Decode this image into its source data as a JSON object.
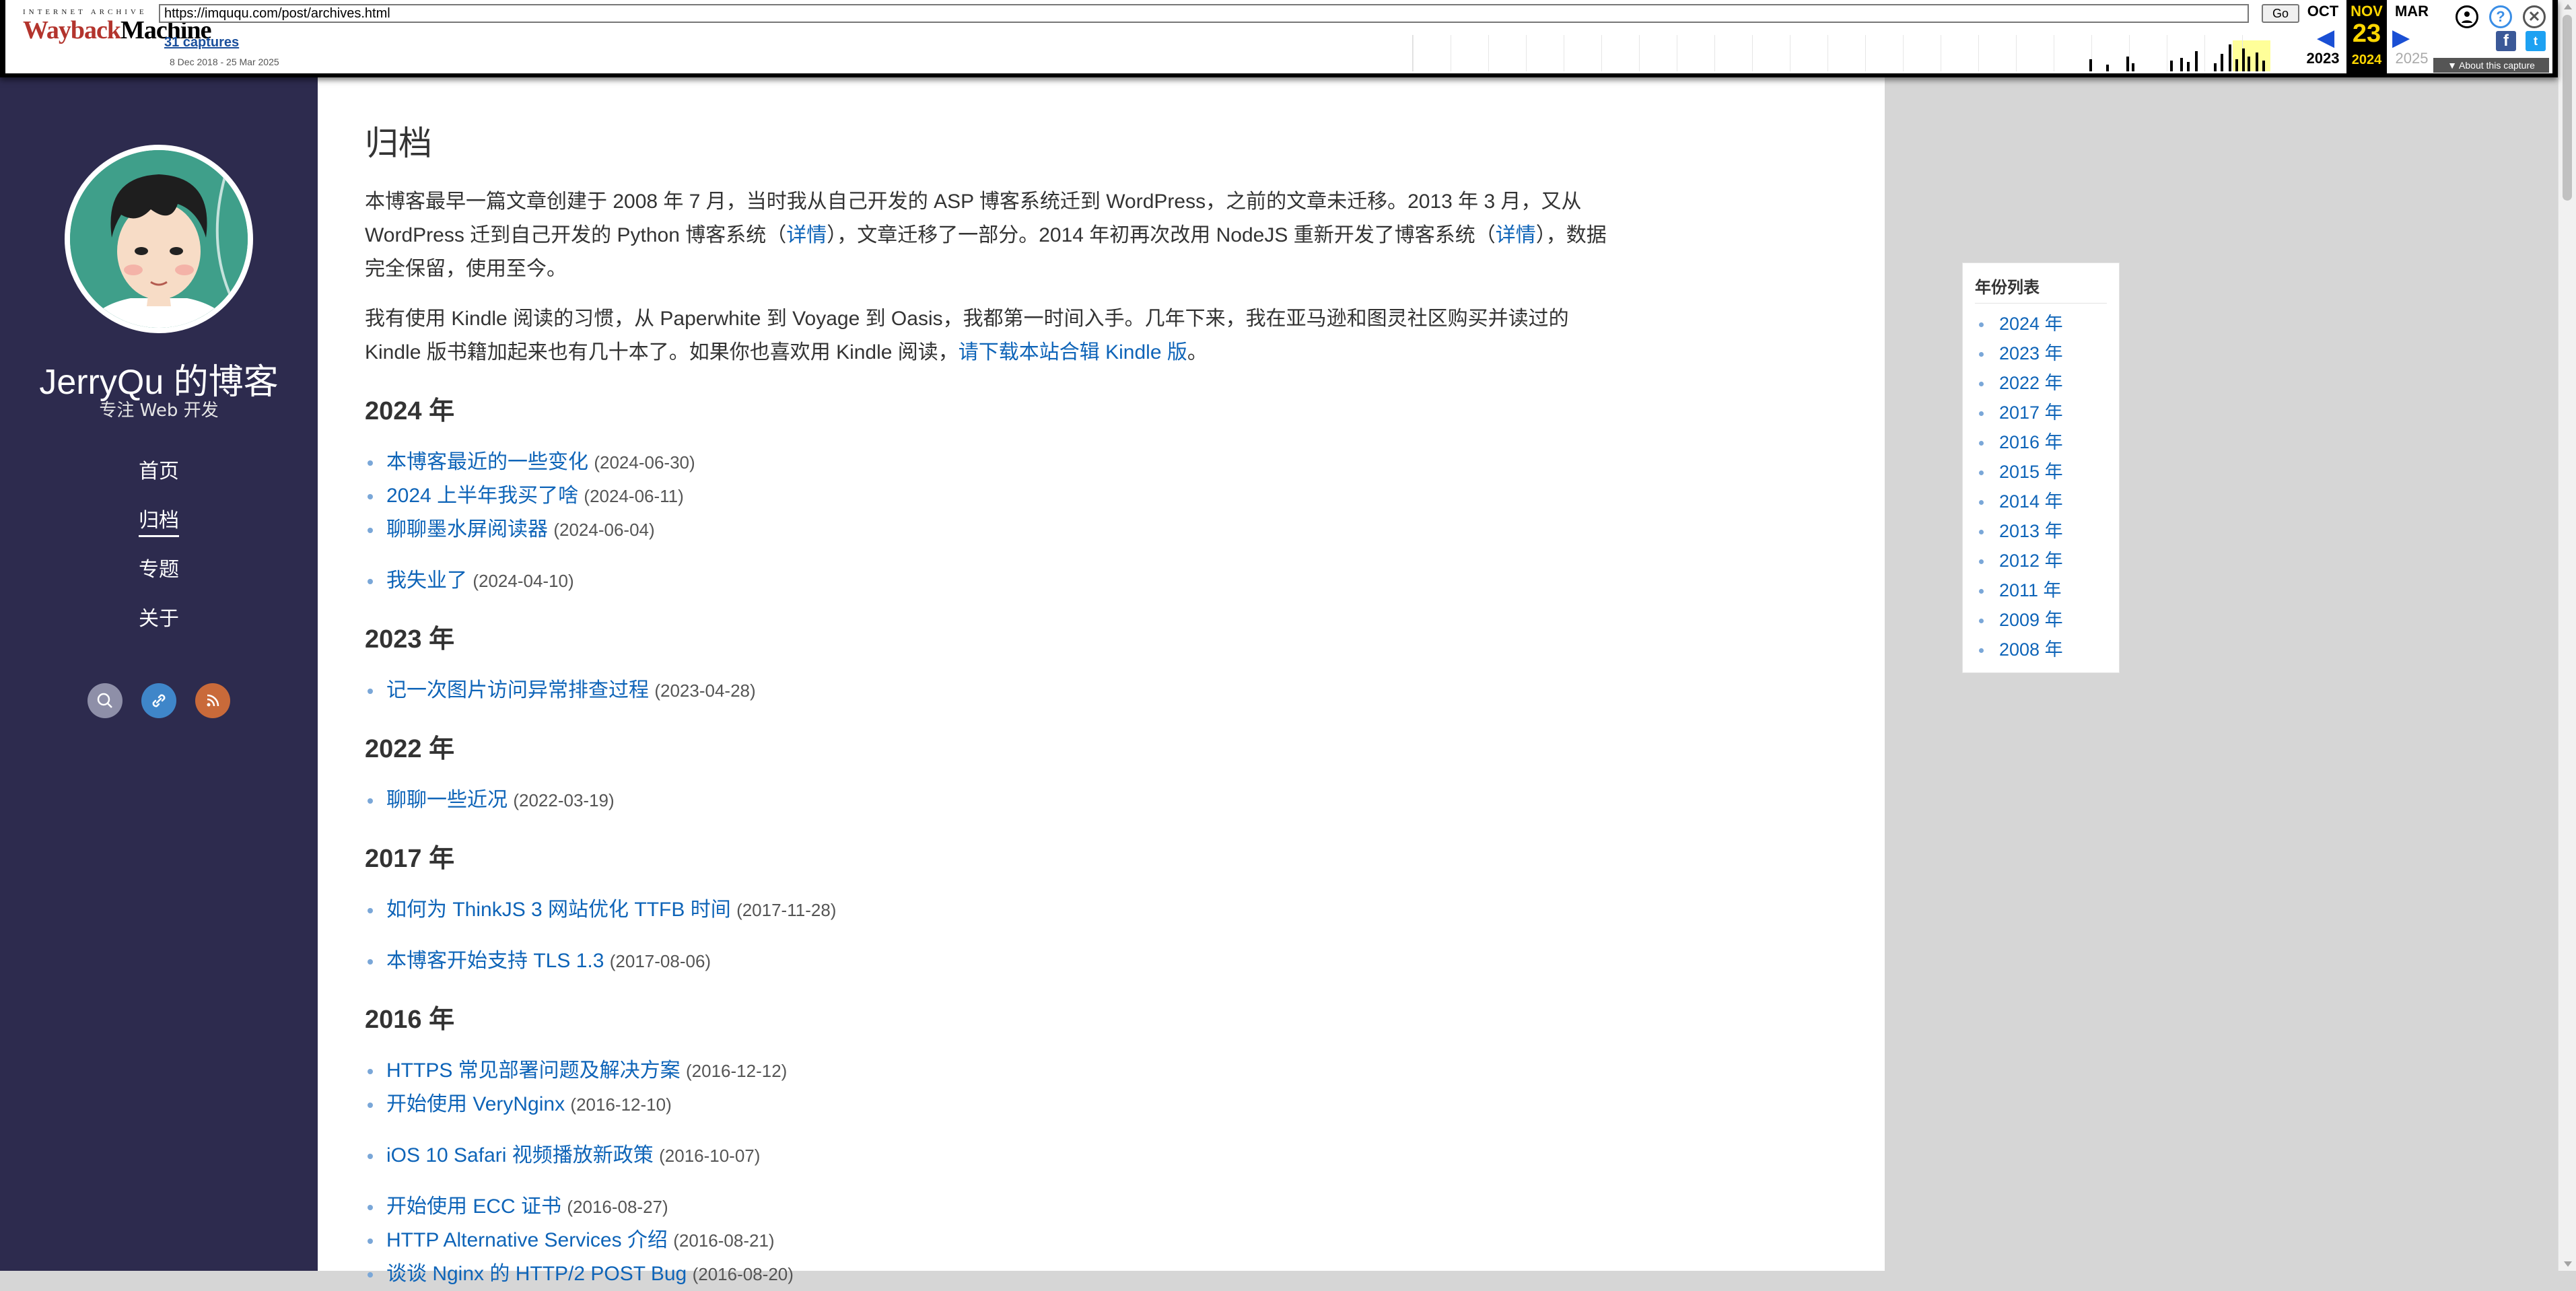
{
  "wayback": {
    "logo_top": "INTERNET ARCHIVE",
    "logo_main_a": "Wayback",
    "logo_main_b": "Machine",
    "url": "https://imququ.com/post/archives.html",
    "go_label": "Go",
    "captures": "31 captures",
    "range": "8 Dec 2018 - 25 Mar 2025",
    "prev_month": "OCT",
    "cur_month": "NOV",
    "next_month": "MAR",
    "cur_day": "23",
    "prev_year": "2023",
    "cur_year": "2024",
    "next_year": "2025",
    "about": "▼ About this capture",
    "icons": [
      "user-icon",
      "help-icon",
      "close-icon",
      "facebook-icon",
      "twitter-icon"
    ]
  },
  "sidebar": {
    "title": "JerryQu 的博客",
    "subtitle": "专注 Web 开发",
    "nav": [
      {
        "label": "首页",
        "active": false
      },
      {
        "label": "归档",
        "active": true
      },
      {
        "label": "专题",
        "active": false
      },
      {
        "label": "关于",
        "active": false
      }
    ],
    "social": [
      "search-icon",
      "link-icon",
      "rss-icon"
    ]
  },
  "main": {
    "title": "归档",
    "intro1": {
      "a": "本博客最早一篇文章创建于 2008 年 7 月，当时我从自己开发的 ASP 博客系统迁到 WordPress，之前的文章未迁移。2013 年 3 月，又从 WordPress 迁到自己开发的 Python 博客系统（",
      "link1": "详情",
      "b": "），文章迁移了一部分。2014 年初再次改用 NodeJS 重新开发了博客系统（",
      "link2": "详情",
      "c": "），数据完全保留，使用至今。"
    },
    "intro2": {
      "a": "我有使用 Kindle 阅读的习惯，从 Paperwhite 到 Voyage 到 Oasis，我都第一时间入手。几年下来，我在亚马逊和图灵社区购买并读过的 Kindle 版书籍加起来也有几十本了。如果你也喜欢用 Kindle 阅读，",
      "link": "请下载本站合辑 Kindle 版",
      "b": "。"
    },
    "years": [
      {
        "year": "2024 年",
        "posts": [
          {
            "title": "本博客最近的一些变化",
            "date": "(2024-06-30)",
            "gap": false
          },
          {
            "title": "2024 上半年我买了啥",
            "date": "(2024-06-11)",
            "gap": false
          },
          {
            "title": "聊聊墨水屏阅读器",
            "date": "(2024-06-04)",
            "gap": false
          },
          {
            "title": "我失业了",
            "date": "(2024-04-10)",
            "gap": true
          }
        ]
      },
      {
        "year": "2023 年",
        "posts": [
          {
            "title": "记一次图片访问异常排查过程",
            "date": "(2023-04-28)",
            "gap": false
          }
        ]
      },
      {
        "year": "2022 年",
        "posts": [
          {
            "title": "聊聊一些近况",
            "date": "(2022-03-19)",
            "gap": false
          }
        ]
      },
      {
        "year": "2017 年",
        "posts": [
          {
            "title": "如何为 ThinkJS 3 网站优化 TTFB 时间",
            "date": "(2017-11-28)",
            "gap": false
          },
          {
            "title": "本博客开始支持 TLS 1.3",
            "date": "(2017-08-06)",
            "gap": true
          }
        ]
      },
      {
        "year": "2016 年",
        "posts": [
          {
            "title": "HTTPS 常见部署问题及解决方案",
            "date": "(2016-12-12)",
            "gap": false
          },
          {
            "title": "开始使用 VeryNginx",
            "date": "(2016-12-10)",
            "gap": false
          },
          {
            "title": "iOS 10 Safari 视频播放新政策",
            "date": "(2016-10-07)",
            "gap": true
          },
          {
            "title": "开始使用 ECC 证书",
            "date": "(2016-08-27)",
            "gap": true
          },
          {
            "title": "HTTP Alternative Services 介绍",
            "date": "(2016-08-21)",
            "gap": false
          },
          {
            "title": "谈谈 Nginx 的 HTTP/2 POST Bug",
            "date": "(2016-08-20)",
            "gap": false
          }
        ]
      }
    ]
  },
  "toc": {
    "title": "年份列表",
    "items": [
      "2024 年",
      "2023 年",
      "2022 年",
      "2017 年",
      "2016 年",
      "2015 年",
      "2014 年",
      "2013 年",
      "2012 年",
      "2011 年",
      "2009 年",
      "2008 年"
    ]
  },
  "colors": {
    "sidebar_bg": "#2d2b4e",
    "link": "#0e64b8",
    "text": "#333333"
  }
}
